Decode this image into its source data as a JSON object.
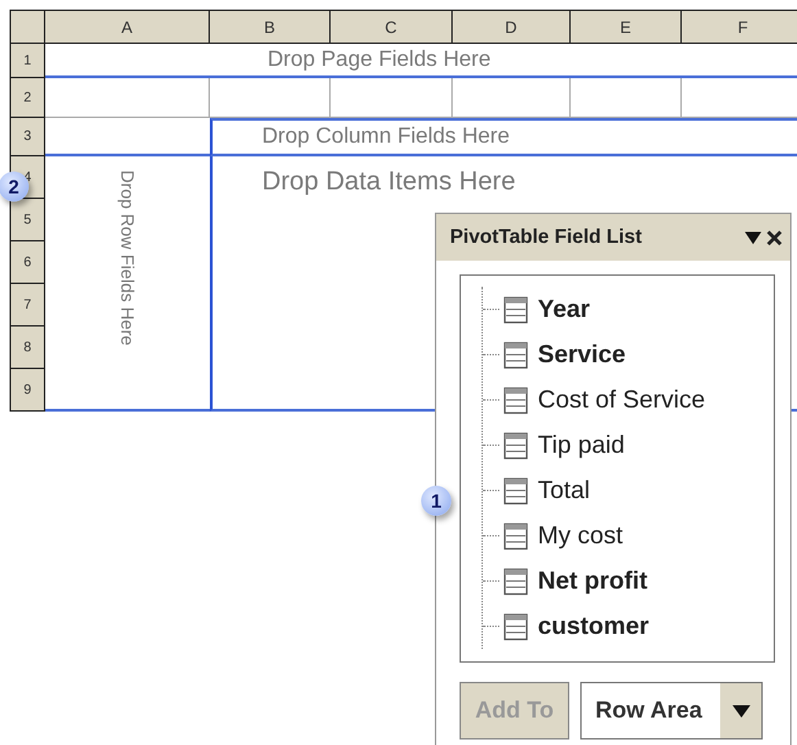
{
  "sheet": {
    "columns": [
      "A",
      "B",
      "C",
      "D",
      "E",
      "F"
    ],
    "rows": [
      "1",
      "2",
      "3",
      "4",
      "5",
      "6",
      "7",
      "8",
      "9"
    ],
    "page_area": "Drop Page Fields Here",
    "column_area": "Drop Column Fields Here",
    "row_area": "Drop Row Fields Here",
    "data_area": "Drop Data Items Here"
  },
  "field_list": {
    "title": "PivotTable Field List",
    "fields": [
      {
        "label": "Year",
        "in_use": true
      },
      {
        "label": "Service",
        "in_use": true
      },
      {
        "label": "Cost of Service",
        "in_use": false
      },
      {
        "label": "Tip paid",
        "in_use": false
      },
      {
        "label": "Total",
        "in_use": false
      },
      {
        "label": "My cost",
        "in_use": false
      },
      {
        "label": "Net profit",
        "in_use": true
      },
      {
        "label": "customer",
        "in_use": true
      }
    ],
    "add_button": {
      "label": "Add To",
      "disabled": true
    },
    "area_dropdown": {
      "value": "Row Area"
    }
  },
  "callouts": [
    "1",
    "2"
  ]
}
